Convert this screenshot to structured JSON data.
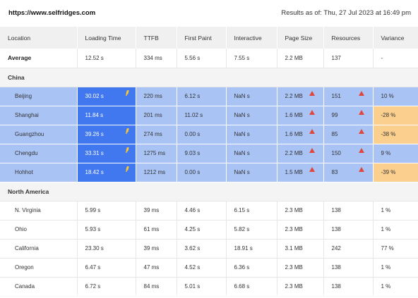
{
  "header": {
    "url": "https://www.selfridges.com",
    "results_as_of": "Results as of: Thu, 27 Jul 2023 at 16:49 pm"
  },
  "columns": [
    "Location",
    "Loading Time",
    "TTFB",
    "First Paint",
    "Interactive",
    "Page Size",
    "Resources",
    "Variance"
  ],
  "average": {
    "label": "Average",
    "loading_time": "12.52 s",
    "ttfb": "334 ms",
    "first_paint": "5.56 s",
    "interactive": "7.55 s",
    "page_size": "2.2 MB",
    "resources": "137",
    "variance": "-"
  },
  "groups": [
    {
      "name": "China",
      "rows": [
        {
          "location": "Beijing",
          "loading_time": "30.02 s",
          "ttfb": "220 ms",
          "first_paint": "6.12 s",
          "interactive": "NaN s",
          "page_size": "2.2 MB",
          "resources": "151",
          "variance": "10 %"
        },
        {
          "location": "Shanghai",
          "loading_time": "11.84 s",
          "ttfb": "201 ms",
          "first_paint": "11.02 s",
          "interactive": "NaN s",
          "page_size": "1.6 MB",
          "resources": "99",
          "variance": "-28 %"
        },
        {
          "location": "Guangzhou",
          "loading_time": "39.26 s",
          "ttfb": "274 ms",
          "first_paint": "0.00 s",
          "interactive": "NaN s",
          "page_size": "1.6 MB",
          "resources": "85",
          "variance": "-38 %"
        },
        {
          "location": "Chengdu",
          "loading_time": "33.31 s",
          "ttfb": "1275 ms",
          "first_paint": "9.03 s",
          "interactive": "NaN s",
          "page_size": "2.2 MB",
          "resources": "150",
          "variance": "9 %"
        },
        {
          "location": "Hohhot",
          "loading_time": "18.42 s",
          "ttfb": "1212 ms",
          "first_paint": "0.00 s",
          "interactive": "NaN s",
          "page_size": "1.5 MB",
          "resources": "83",
          "variance": "-39 %"
        }
      ]
    },
    {
      "name": "North America",
      "rows": [
        {
          "location": "N. Virginia",
          "loading_time": "5.99 s",
          "ttfb": "39 ms",
          "first_paint": "4.46 s",
          "interactive": "6.15 s",
          "page_size": "2.3 MB",
          "resources": "138",
          "variance": "1 %"
        },
        {
          "location": "Ohio",
          "loading_time": "5.93 s",
          "ttfb": "61 ms",
          "first_paint": "4.25 s",
          "interactive": "5.82 s",
          "page_size": "2.3 MB",
          "resources": "138",
          "variance": "1 %"
        },
        {
          "location": "California",
          "loading_time": "23.30 s",
          "ttfb": "39 ms",
          "first_paint": "3.62 s",
          "interactive": "18.91 s",
          "page_size": "3.1 MB",
          "resources": "242",
          "variance": "77 %"
        },
        {
          "location": "Oregon",
          "loading_time": "6.47 s",
          "ttfb": "47 ms",
          "first_paint": "4.52 s",
          "interactive": "6.36 s",
          "page_size": "2.3 MB",
          "resources": "138",
          "variance": "1 %"
        },
        {
          "location": "Canada",
          "loading_time": "6.72 s",
          "ttfb": "84 ms",
          "first_paint": "5.01 s",
          "interactive": "6.68 s",
          "page_size": "2.3 MB",
          "resources": "138",
          "variance": "1 %"
        }
      ]
    }
  ],
  "colors": {
    "china_row": "#a9c3f5",
    "loading_highlight": "#4178ef",
    "negative_variance": "#fbd08f",
    "warning_icon": "#e0463c",
    "bolt_icon": "#f7c734"
  }
}
